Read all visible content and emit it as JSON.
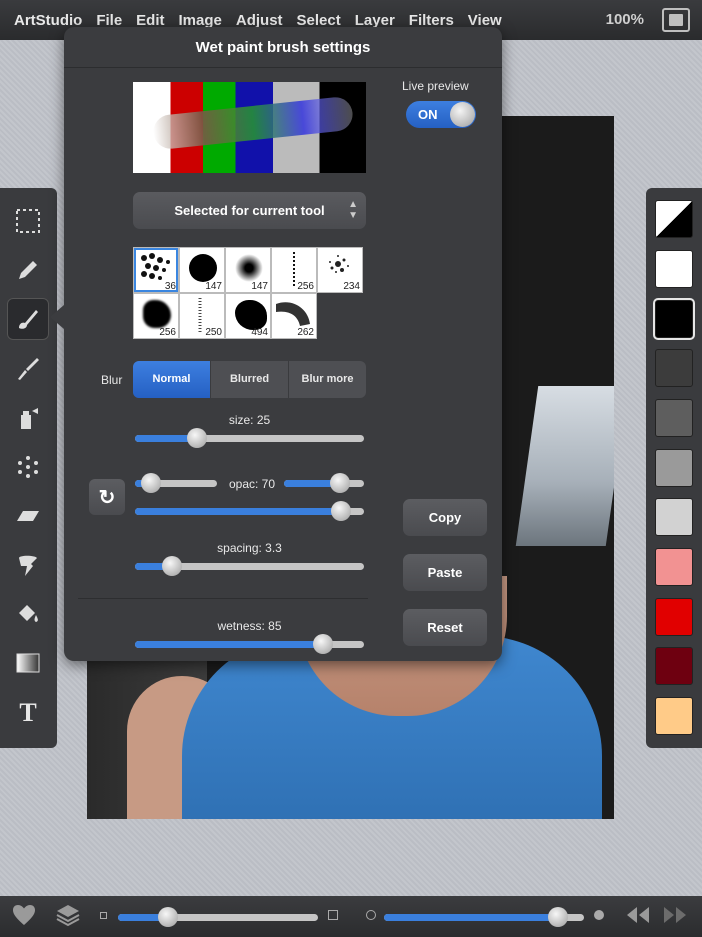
{
  "menubar": {
    "items": [
      "ArtStudio",
      "File",
      "Edit",
      "Image",
      "Adjust",
      "Select",
      "Layer",
      "Filters",
      "View"
    ],
    "zoom": "100%"
  },
  "popover": {
    "title": "Wet paint brush settings",
    "live_preview_label": "Live preview",
    "live_preview_state": "ON",
    "brush_source": "Selected for current tool",
    "brushes": [
      {
        "label": "36",
        "selected": true
      },
      {
        "label": "147",
        "selected": false
      },
      {
        "label": "147",
        "selected": false
      },
      {
        "label": "256",
        "selected": false
      },
      {
        "label": "234",
        "selected": false
      },
      {
        "label": "256",
        "selected": false
      },
      {
        "label": "250",
        "selected": false
      },
      {
        "label": "494",
        "selected": false
      },
      {
        "label": "262",
        "selected": false
      }
    ],
    "blur_label": "Blur",
    "blur_options": [
      "Normal",
      "Blurred",
      "Blur more"
    ],
    "blur_selected": "Normal",
    "size_label": "size: 25",
    "size_level": 0.27,
    "opac_label": "opac: 70",
    "opac_min_level": 0.2,
    "opac_max_level": 0.7,
    "opac_level": 0.9,
    "spacing_label": "spacing: 3.3",
    "spacing_level": 0.16,
    "wetness_label": "wetness: 85",
    "wetness_level": 0.82,
    "copy_label": "Copy",
    "paste_label": "Paste",
    "reset_label": "Reset"
  },
  "toolbar": {
    "tools": [
      "selection-icon",
      "pencil-icon",
      "brush-icon",
      "paint-brush-icon",
      "spray-can-icon",
      "dots-icon",
      "eraser-icon",
      "smudge-icon",
      "fill-bucket-icon",
      "gradient-icon",
      "text-icon"
    ],
    "text_tool_glyph": "T",
    "active": "brush-icon"
  },
  "palette": {
    "colors": [
      "#000000",
      "#ffffff",
      "#000000",
      "#3c3c3c",
      "#5e5e5e",
      "#9a9a9a",
      "#d2d2d2",
      "#f29292",
      "#e10000",
      "#6e0010",
      "#ffcb88"
    ],
    "selected_index": 2
  },
  "bottombar": {
    "size_slider_level": 0.25,
    "opacity_slider_level": 0.87
  }
}
